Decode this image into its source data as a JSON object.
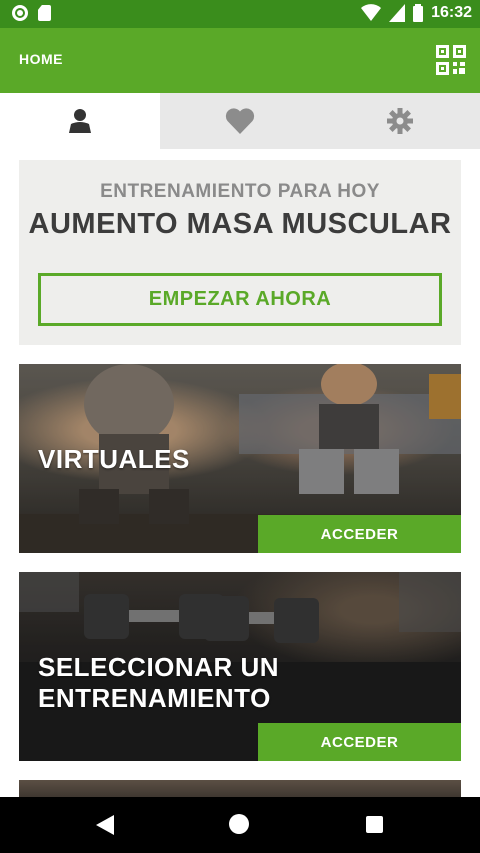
{
  "status_bar": {
    "time": "16:32",
    "icons": [
      "notification-dot-icon",
      "sd-card-icon",
      "wifi-icon",
      "signal-icon",
      "battery-icon"
    ]
  },
  "app_bar": {
    "title": "HOME",
    "action_icon": "qr-code-icon"
  },
  "tabs": [
    {
      "icon": "person-icon",
      "active": true
    },
    {
      "icon": "heart-icon",
      "active": false
    },
    {
      "icon": "gear-icon",
      "active": false
    }
  ],
  "training_card": {
    "subtitle": "ENTRENAMIENTO PARA HOY",
    "title": "AUMENTO MASA MUSCULAR",
    "start_label": "EMPEZAR AHORA"
  },
  "cards": [
    {
      "title": "VIRTUALES",
      "button_label": "ACCEDER",
      "image": "people-squatting-photo"
    },
    {
      "title": "SELECCIONAR UN ENTRENAMIENTO",
      "button_label": "ACCEDER",
      "image": "dumbbells-photo"
    }
  ],
  "colors": {
    "status_bar": "#3a8d1c",
    "brand_green": "#5aa928",
    "tab_bg": "#e8e8e8",
    "card_bg": "#eeeeec"
  },
  "nav_bar": {
    "icons": [
      "back-icon",
      "home-icon",
      "recents-icon"
    ]
  }
}
